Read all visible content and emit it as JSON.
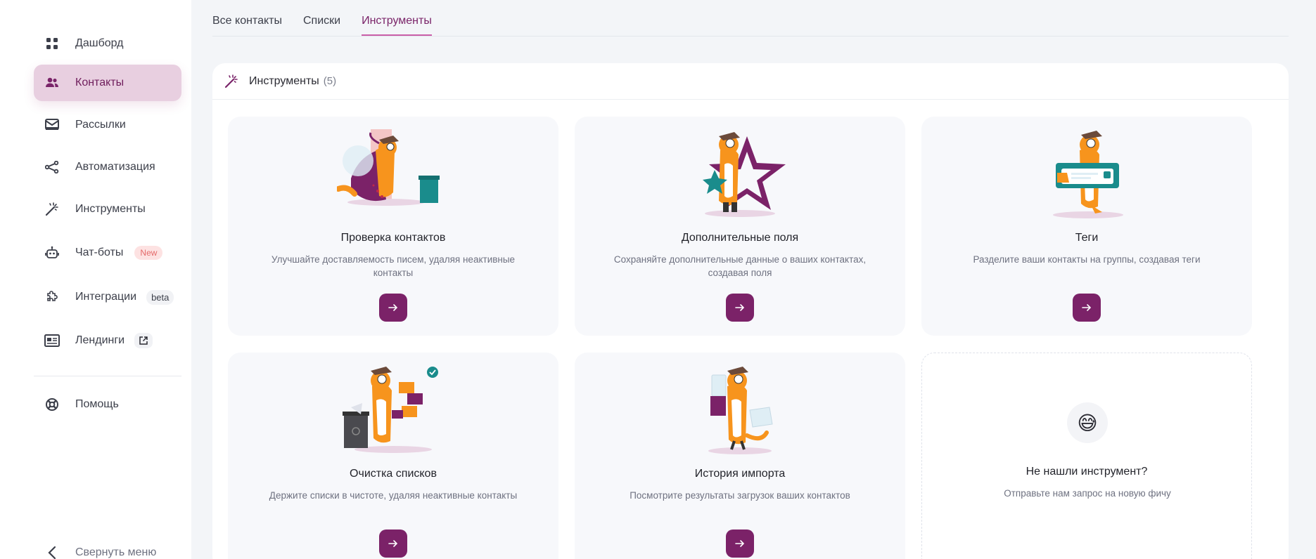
{
  "sidebar": {
    "items": [
      {
        "label": "Дашборд",
        "icon": "grid-icon"
      },
      {
        "label": "Контакты",
        "icon": "users-icon"
      },
      {
        "label": "Рассылки",
        "icon": "mail-icon"
      },
      {
        "label": "Автоматизация",
        "icon": "share-nodes-icon"
      },
      {
        "label": "Инструменты",
        "icon": "magic-wand-icon"
      },
      {
        "label": "Чат-боты",
        "icon": "robot-icon",
        "badge": "New"
      },
      {
        "label": "Интеграции",
        "icon": "puzzle-icon",
        "badge": "beta"
      },
      {
        "label": "Лендинги",
        "icon": "landing-icon"
      },
      {
        "label": "Помощь",
        "icon": "lifebuoy-icon"
      }
    ],
    "collapse_label": "Свернуть меню"
  },
  "tabs": [
    "Все контакты",
    "Списки",
    "Инструменты"
  ],
  "panel": {
    "title": "Инструменты",
    "count": "(5)"
  },
  "cards": [
    {
      "title": "Проверка контактов",
      "desc": "Улучшайте доставляемость писем, удаляя неактивные контакты"
    },
    {
      "title": "Дополнительные поля",
      "desc": "Сохраняйте дополнительные данные о ваших контактах, создавая поля"
    },
    {
      "title": "Теги",
      "desc": "Разделите ваши контакты на группы, создавая теги"
    },
    {
      "title": "Очистка списков",
      "desc": "Держите списки в чистоте, удаляя неактивные контакты"
    },
    {
      "title": "История импорта",
      "desc": "Посмотрите результаты загрузок ваших контактов"
    }
  ],
  "request_card": {
    "title": "Не нашли инструмент?",
    "desc": "Отправьте нам запрос на новую фичу",
    "emoji": "😅"
  },
  "colors": {
    "accent": "#7b2268",
    "active_nav_bg": "#e8cfe0",
    "new_badge": "#e46a6a"
  }
}
